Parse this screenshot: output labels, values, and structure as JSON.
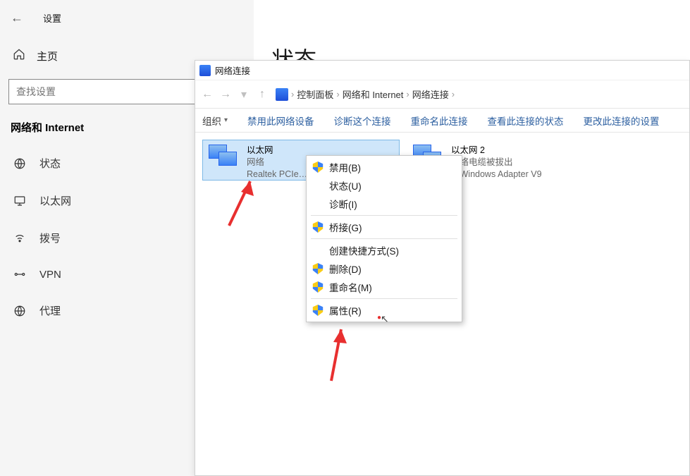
{
  "settings": {
    "title": "设置",
    "home": "主页",
    "search_placeholder": "查找设置",
    "section": "网络和 Internet",
    "nav": {
      "status": "状态",
      "ethernet": "以太网",
      "dialup": "拨号",
      "vpn": "VPN",
      "proxy": "代理"
    }
  },
  "main_heading": "状态",
  "explorer": {
    "window_title": "网络连接",
    "breadcrumbs": {
      "b1": "控制面板",
      "b2": "网络和 Internet",
      "b3": "网络连接"
    },
    "toolbar": {
      "organize": "组织",
      "disable": "禁用此网络设备",
      "diagnose": "诊断这个连接",
      "rename": "重命名此连接",
      "viewstatus": "查看此连接的状态",
      "changeset": "更改此连接的设置"
    },
    "adapters": [
      {
        "name": "以太网",
        "line2": "网络",
        "line3": "Realtek PCIe…"
      },
      {
        "name": "以太网 2",
        "line2": "网络电缆被拔出",
        "line3": "P-Windows Adapter V9"
      }
    ],
    "context_menu": {
      "disable": "禁用(B)",
      "status": "状态(U)",
      "diagnose": "诊断(I)",
      "bridge": "桥接(G)",
      "shortcut": "创建快捷方式(S)",
      "delete": "删除(D)",
      "rename": "重命名(M)",
      "properties": "属性(R)"
    }
  }
}
